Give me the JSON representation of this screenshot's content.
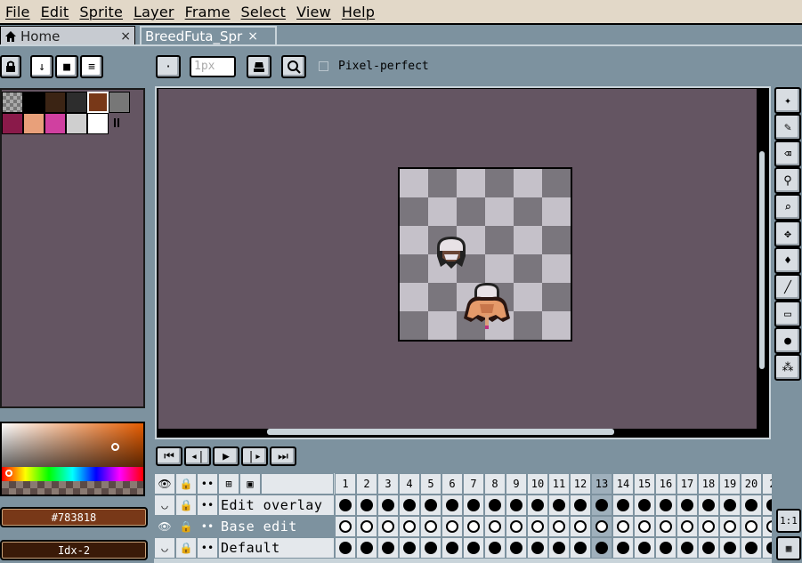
{
  "menubar": {
    "items": [
      "File",
      "Edit",
      "Sprite",
      "Layer",
      "Frame",
      "Select",
      "View",
      "Help"
    ]
  },
  "tabs": [
    {
      "label": "Home",
      "close": "×"
    },
    {
      "label": "BreedFuta_Spr",
      "close": "×"
    }
  ],
  "toolbar": {
    "brush_size_placeholder": "1px",
    "pixel_perfect_label": "Pixel-perfect"
  },
  "palette": {
    "swatches": [
      "#8a8a8a",
      "#000000",
      "#3b2414",
      "#2d2d2d",
      "#783818",
      "#777777",
      "#8a1a4a",
      "#e8a07a",
      "#d040a0",
      "#cfcfcf",
      "#ffffff"
    ]
  },
  "color": {
    "hex_label": "#783818",
    "index_label": "Idx-2",
    "accent": "#783818"
  },
  "timeline": {
    "frame_numbers": [
      "1",
      "2",
      "3",
      "4",
      "5",
      "6",
      "7",
      "8",
      "9",
      "10",
      "11",
      "12",
      "13",
      "14",
      "15",
      "16",
      "17",
      "18",
      "19",
      "20",
      "2"
    ],
    "current_frame": "13",
    "layers": [
      {
        "name": "Edit overlay",
        "selected": false,
        "cels": "filled"
      },
      {
        "name": "Base edit",
        "selected": true,
        "cels": "empty"
      },
      {
        "name": "Default",
        "selected": false,
        "cels": "filled"
      }
    ],
    "zoom_button": "1:1"
  }
}
